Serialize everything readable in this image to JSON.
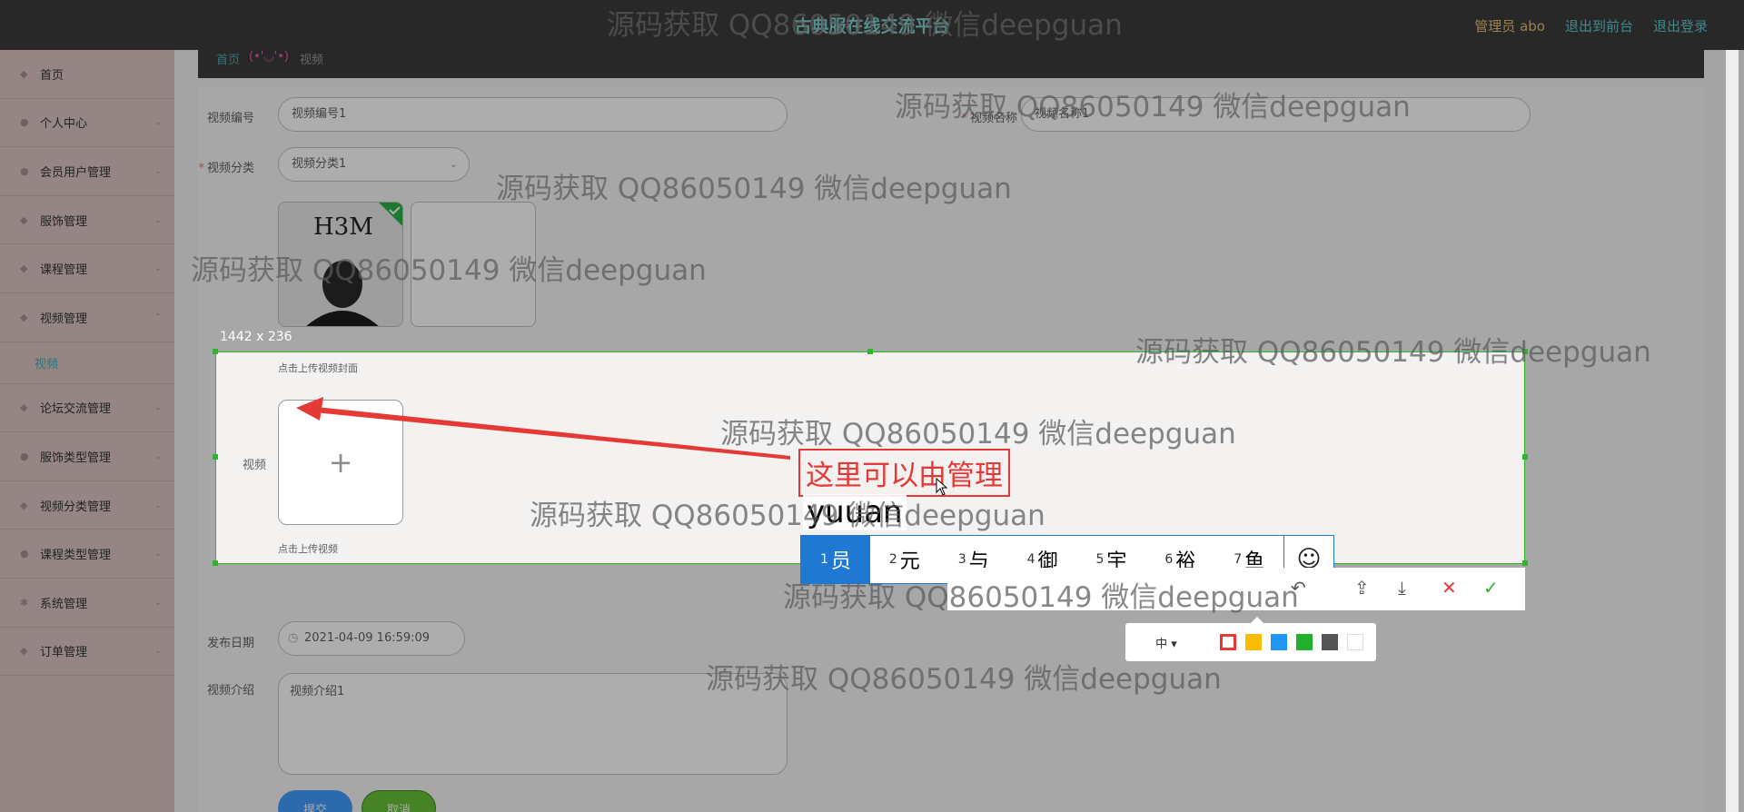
{
  "topbar": {
    "title": "古典服在线交流平台",
    "admin": "管理员 abo",
    "front_link": "退出到前台",
    "logout_link": "退出登录"
  },
  "sidebar": {
    "items": [
      {
        "label": "首页"
      },
      {
        "label": "个人中心"
      },
      {
        "label": "会员用户管理"
      },
      {
        "label": "服饰管理"
      },
      {
        "label": "课程管理"
      },
      {
        "label": "视频管理"
      },
      {
        "label": "视频"
      },
      {
        "label": "论坛交流管理"
      },
      {
        "label": "服饰类型管理"
      },
      {
        "label": "视频分类管理"
      },
      {
        "label": "课程类型管理"
      },
      {
        "label": "系统管理"
      },
      {
        "label": "订单管理"
      }
    ]
  },
  "breadcrumb": {
    "home": "首页",
    "face": "(•'◡'•)",
    "current": "视频"
  },
  "form": {
    "video_no_label": "视频编号",
    "video_no_value": "视频编号1",
    "video_name_label": "视频名称",
    "video_name_value": "视频名称1",
    "category_label": "视频分类",
    "category_value": "视频分类1",
    "cover_hint": "点击上传视频封面",
    "video_label": "视频",
    "video_hint": "点击上传视频",
    "date_label": "发布日期",
    "date_value": "2021-04-09 16:59:09",
    "intro_label": "视频介绍",
    "intro_value": "视频介绍1",
    "submit_label": "提交",
    "cancel_label": "取消"
  },
  "cover_image_text": "H3M",
  "screenshot_tool": {
    "size_label": "1442 x 236",
    "annotation_text": "这里可以由管理",
    "ime_composition": "yuuan",
    "candidates": [
      {
        "num": "1",
        "char": "员"
      },
      {
        "num": "2",
        "char": "元"
      },
      {
        "num": "3",
        "char": "与"
      },
      {
        "num": "4",
        "char": "御"
      },
      {
        "num": "5",
        "char": "宇"
      },
      {
        "num": "6",
        "char": "裕"
      },
      {
        "num": "7",
        "char": "鱼"
      }
    ],
    "font_size_option": "中",
    "palette_colors": [
      "#e53935",
      "#fbbc05",
      "#2196f3",
      "#22b02a",
      "#555555",
      "#ffffff"
    ]
  },
  "watermark": "源码获取 QQ86050149 微信deepguan"
}
